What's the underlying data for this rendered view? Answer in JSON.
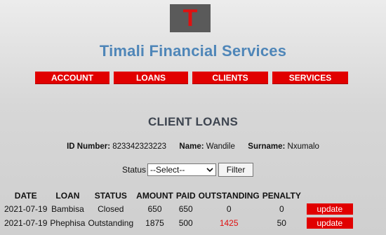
{
  "logo": {
    "letter": "T"
  },
  "brand": {
    "title": "Timali Financial Services"
  },
  "nav": {
    "items": [
      {
        "label": "ACCOUNT"
      },
      {
        "label": "LOANS"
      },
      {
        "label": "CLIENTS"
      },
      {
        "label": "SERVICES"
      }
    ]
  },
  "page": {
    "title": "CLIENT LOANS"
  },
  "client": {
    "id_label": "ID Number:",
    "id_value": "823342323223",
    "name_label": "Name:",
    "name_value": "Wandile",
    "surname_label": "Surname:",
    "surname_value": "Nxumalo"
  },
  "filter": {
    "status_label": "Status",
    "select_value": "--Select--",
    "button_label": "Filter"
  },
  "table": {
    "headers": {
      "date": "DATE",
      "loan": "LOAN",
      "status": "STATUS",
      "amount": "AMOUNT",
      "paid": "PAID",
      "outstanding": "OUTSTANDING",
      "penalty": "PENALTY"
    },
    "rows": [
      {
        "date": "2021-07-19",
        "loan": "Bambisa",
        "status": "Closed",
        "amount": "650",
        "paid": "650",
        "outstanding": "0",
        "penalty": "0",
        "action": "update"
      },
      {
        "date": "2021-07-19",
        "loan": "Phephisa",
        "status": "Outstanding",
        "amount": "1875",
        "paid": "500",
        "outstanding": "1425",
        "penalty": "50",
        "action": "update"
      }
    ]
  },
  "colors": {
    "accent_red": "#e10000",
    "brand_blue": "#4f86b8",
    "outstanding_red": "#e01010",
    "logo_bg": "#5a5a5a"
  }
}
